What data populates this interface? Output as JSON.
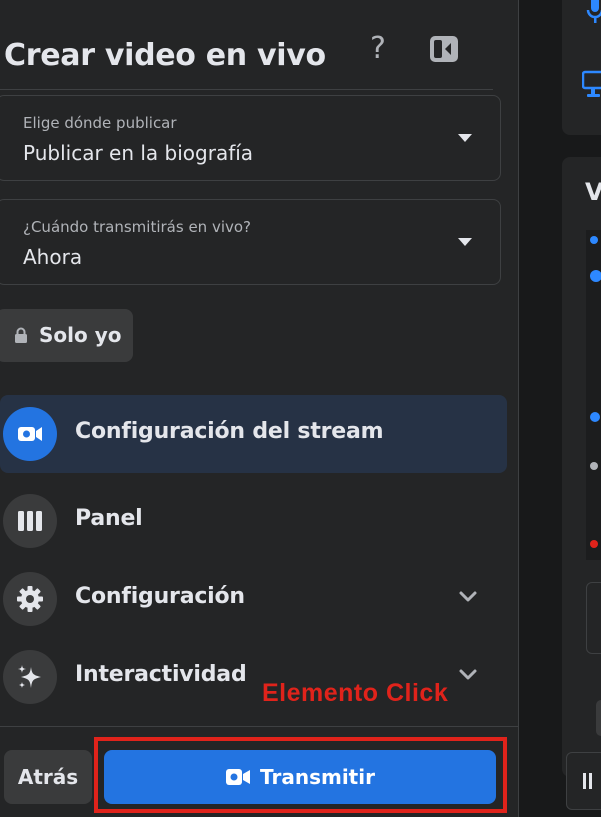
{
  "header": {
    "title": "Crear video en vivo",
    "help_glyph": "?",
    "help_icon": "question-mark-icon",
    "collapse_icon": "sidebar-collapse-icon"
  },
  "publish_select": {
    "label": "Elige dónde publicar",
    "value": "Publicar en la biografía"
  },
  "when_select": {
    "label": "¿Cuándo transmitirás en vivo?",
    "value": "Ahora"
  },
  "privacy": {
    "label": "Solo yo",
    "icon": "lock-icon"
  },
  "nav": {
    "items": [
      {
        "label": "Configuración del stream",
        "icon": "video-camera-icon",
        "active": true
      },
      {
        "label": "Panel",
        "icon": "panel-columns-icon",
        "active": false
      },
      {
        "label": "Configuración",
        "icon": "gear-icon",
        "active": false,
        "expandable": true
      },
      {
        "label": "Interactividad",
        "icon": "sparkles-icon",
        "active": false,
        "expandable": true
      }
    ]
  },
  "annotation": {
    "label": "Elemento Click",
    "color": "#e0231b"
  },
  "footer": {
    "back_label": "Atrás",
    "broadcast_label": "Transmitir",
    "broadcast_icon": "video-camera-icon"
  },
  "right_panel": {
    "heading": "V"
  },
  "colors": {
    "background": "#18191a",
    "panel": "#242526",
    "accent": "#2374e1",
    "active_nav": "#263245",
    "button_secondary": "#3a3b3c",
    "annotation": "#e0231b"
  }
}
